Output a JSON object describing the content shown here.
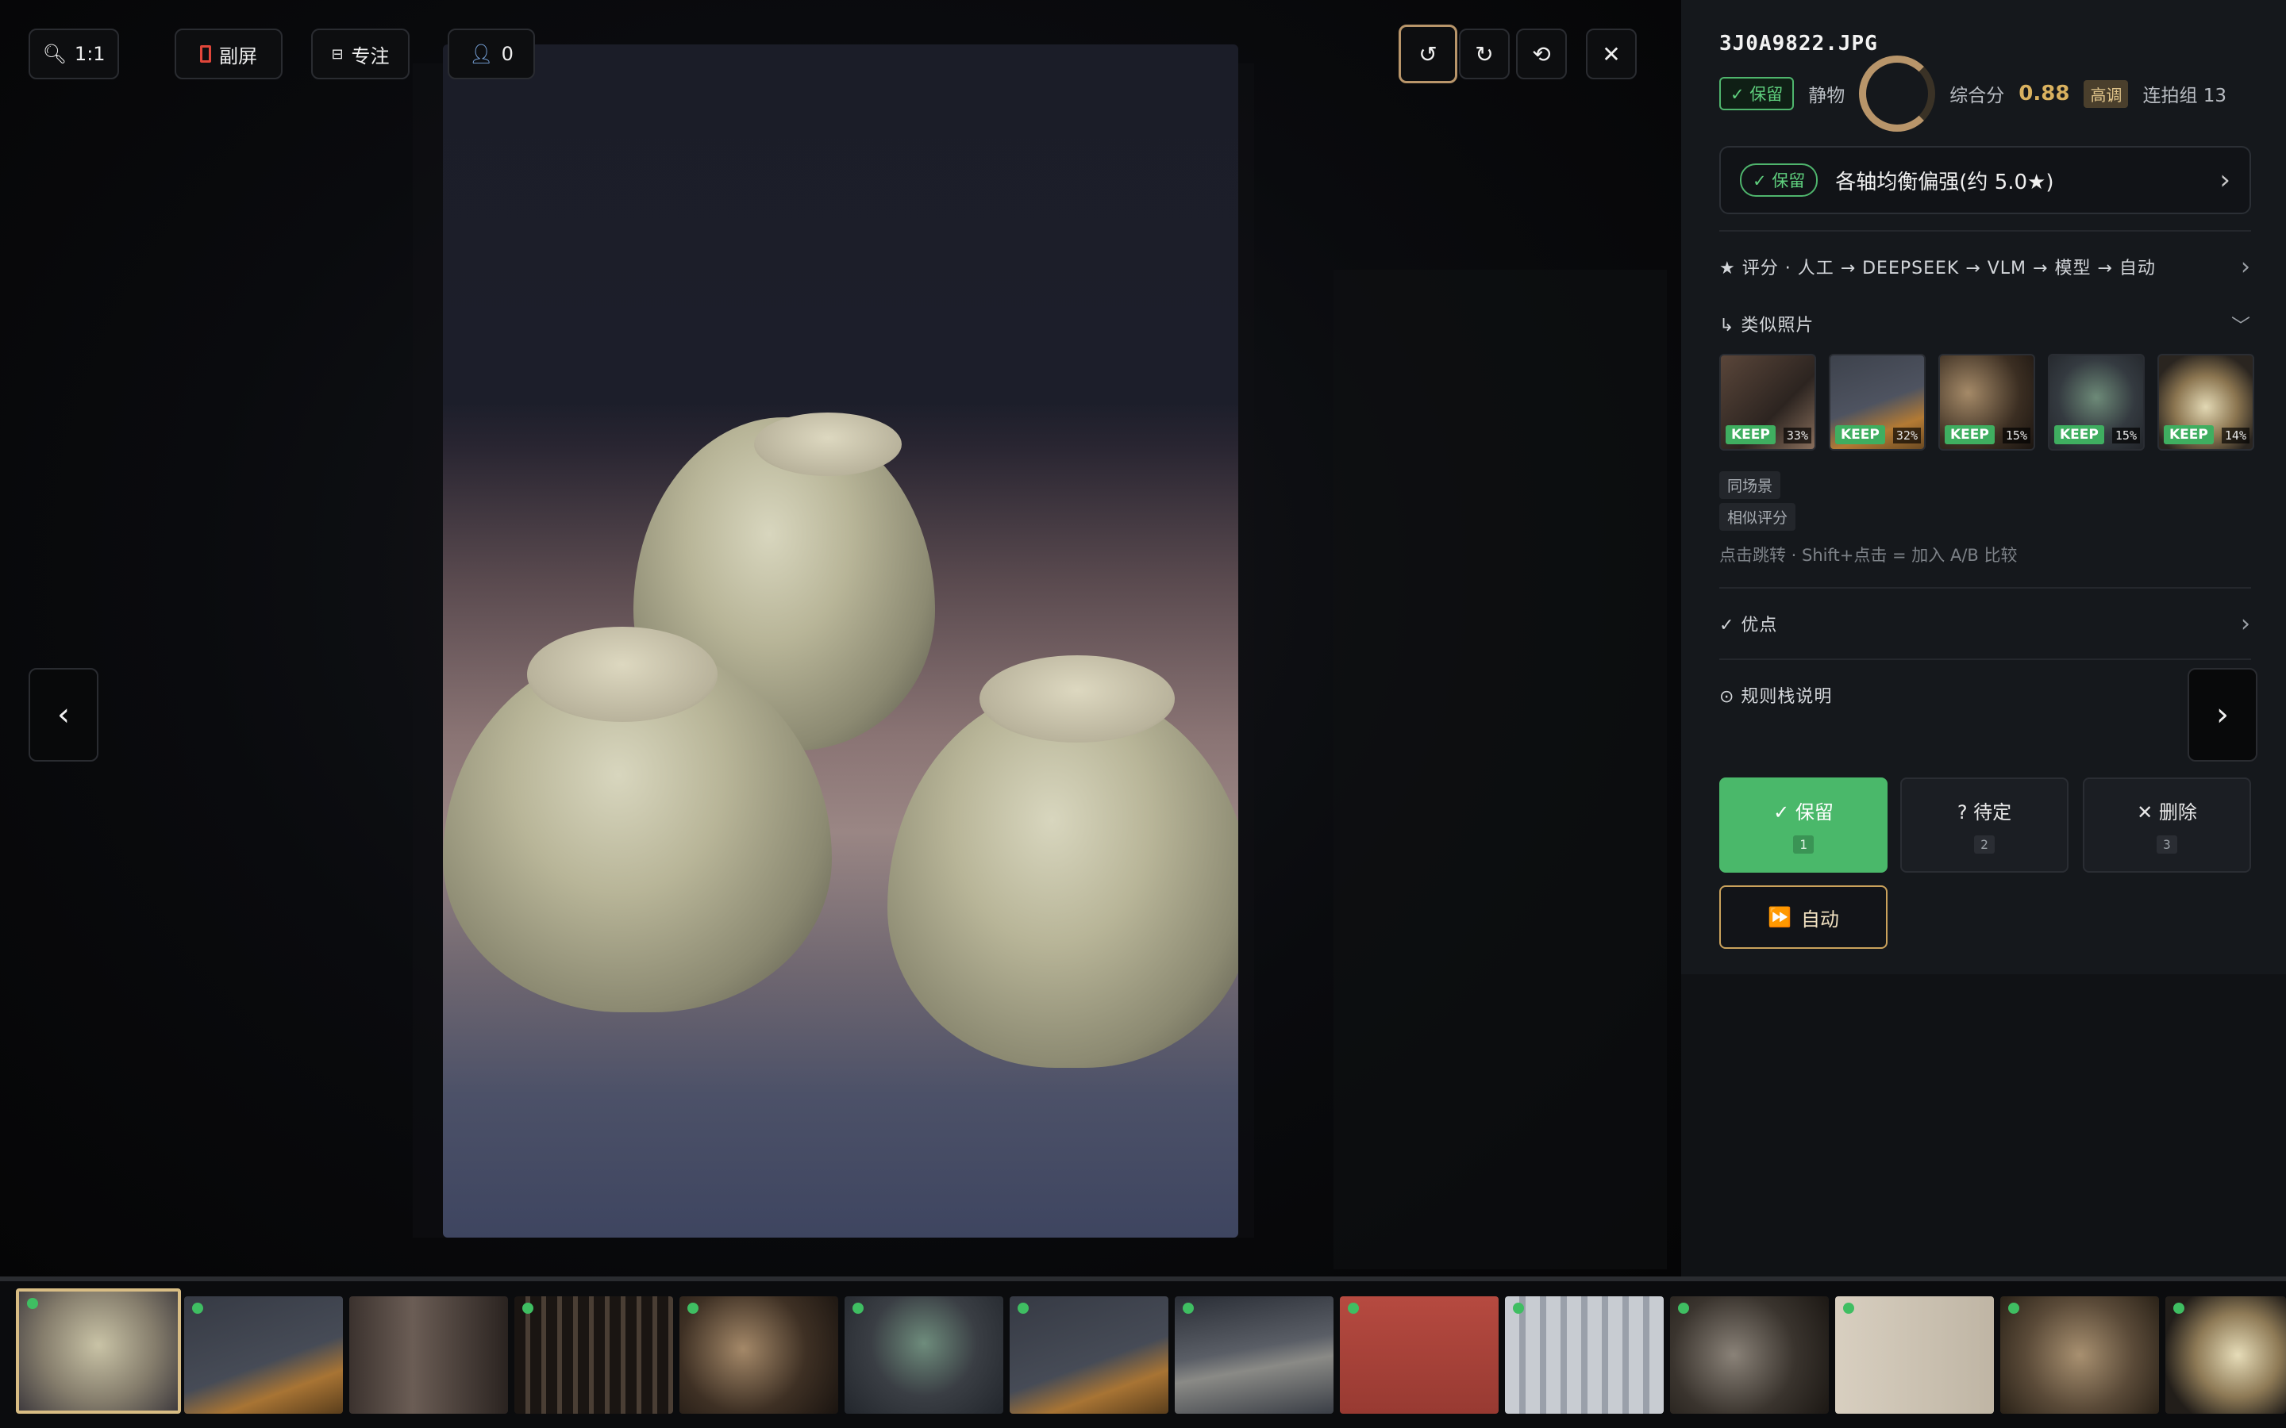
{
  "toolbar": {
    "zoom_label": "1:1",
    "second_screen_label": "副屏",
    "focus_label": "专注",
    "person_count": "0"
  },
  "icons": {
    "zoom": "magnifier-icon",
    "second_screen": "monitor-icon",
    "focus": "focus-icon",
    "person": "person-icon",
    "rotate_left": "↺",
    "rotate_right": "↻",
    "reset": "⟲",
    "close": "✕",
    "prev": "‹",
    "next": "›"
  },
  "photo": {
    "filename": "3J0A9822.JPG",
    "status": "✓ 保留",
    "category": "静物",
    "score_label": "综合分",
    "score_value": "0.88",
    "tone": "高调",
    "burst_group": "连拍组 13"
  },
  "verdict": {
    "pill": "✓ 保留",
    "text": "各轴均衡偏强(约 5.0★)"
  },
  "sections": {
    "scoring": "★ 评分 · 人工 → DEEPSEEK → VLM → 模型 → 自动",
    "similar": "↳ 类似照片",
    "pros": "✓ 优点",
    "rules": "⊙ 规则栈说明"
  },
  "similar": {
    "items": [
      {
        "badge": "KEEP",
        "pct": "33%"
      },
      {
        "badge": "KEEP",
        "pct": "32%"
      },
      {
        "badge": "KEEP",
        "pct": "15%"
      },
      {
        "badge": "KEEP",
        "pct": "15%"
      },
      {
        "badge": "KEEP",
        "pct": "14%"
      }
    ],
    "tag_scene": "同场景",
    "tag_score": "相似评分",
    "hint": "点击跳转 · Shift+点击 = 加入 A/B 比较"
  },
  "actions": {
    "keep_label": "✓ 保留",
    "keep_key": "1",
    "pending_label": "? 待定",
    "pending_key": "2",
    "delete_label": "✕ 删除",
    "delete_key": "3",
    "auto_label": "自动",
    "auto_icon": "⏩"
  },
  "colors": {
    "keep_green": "#4fb56d",
    "accent_gold": "#caa25c",
    "panel_bg": "#15181c"
  }
}
